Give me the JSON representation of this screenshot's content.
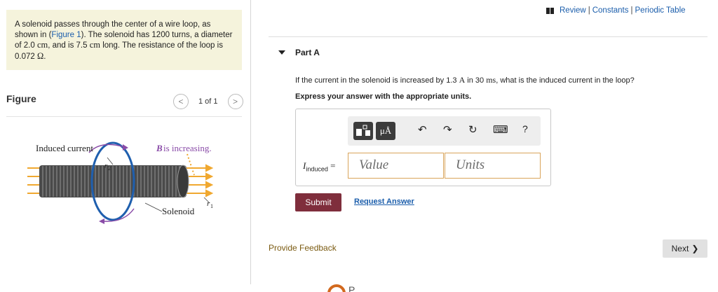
{
  "problem": {
    "text1": "A solenoid passes through the center of a wire loop, as shown in (",
    "figure_link": "Figure 1",
    "text2": "). The solenoid has 1200 turns, a diameter of 2.0 ",
    "unit_cm": "cm",
    "text3": ", and is 7.5 ",
    "unit_cm2": "cm",
    "text4": " long. The resistance of the loop is 0.072 ",
    "unit_ohm": "Ω",
    "text5": "."
  },
  "figure": {
    "heading": "Figure",
    "pager_text": "1 of 1",
    "prev_glyph": "<",
    "next_glyph": ">",
    "label_induced": "Induced current",
    "label_b": "B",
    "label_b_rest": " is increasing.",
    "label_r2": "r",
    "label_r2_sub": "2",
    "label_r1": "r",
    "label_r1_sub": "1",
    "label_solenoid": "Solenoid"
  },
  "top_links": {
    "review": "Review",
    "sep": "|",
    "constants": "Constants",
    "periodic": "Periodic Table"
  },
  "part": {
    "title": "Part A",
    "q1": "If the current in the solenoid is increased by 1.3 ",
    "q_unit_a": "A",
    "q2": " in 30 ",
    "q_unit_ms": "ms",
    "q3": ", what is the induced current in the loop?",
    "instruction": "Express your answer with the appropriate units."
  },
  "toolbar": {
    "units_glyph": "μÅ",
    "undo_glyph": "↶",
    "redo_glyph": "↷",
    "reset_glyph": "↻",
    "keyboard_glyph": "⌨",
    "help_glyph": "?"
  },
  "answer": {
    "label_I": "I",
    "label_sub": "induced",
    "label_eq": " =",
    "value_placeholder": "Value",
    "units_placeholder": "Units"
  },
  "actions": {
    "submit": "Submit",
    "request": "Request Answer",
    "feedback": "Provide Feedback",
    "next": "Next",
    "next_glyph": "❯",
    "bottom_text": "P"
  },
  "colors": {
    "accent_link": "#1a5dab",
    "submit_bg": "#7f2e3c",
    "problem_bg": "#f5f3dc",
    "field_border": "#d9a45a"
  }
}
